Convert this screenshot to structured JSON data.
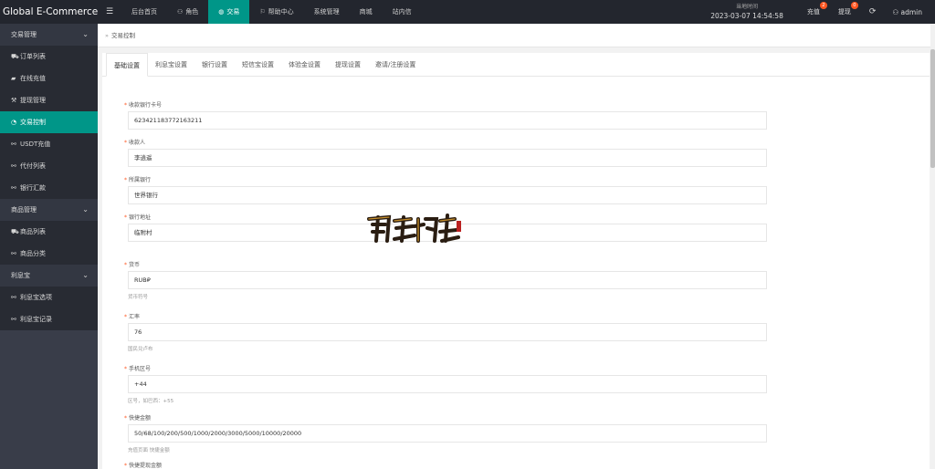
{
  "app": {
    "title": "Global E-Commerce...",
    "menu_toggle": "☰"
  },
  "topnav": [
    {
      "icon": "",
      "label": "后台首页"
    },
    {
      "icon": "user-icon",
      "label": "角色"
    },
    {
      "icon": "globe-icon",
      "label": "交易",
      "active": true
    },
    {
      "icon": "flag-icon",
      "label": "帮助中心"
    },
    {
      "icon": "",
      "label": "系统管理"
    },
    {
      "icon": "",
      "label": "商城"
    },
    {
      "icon": "",
      "label": "站内信"
    }
  ],
  "header": {
    "clock_label": "当地时间",
    "clock_value": "2023-03-07 14:54:58",
    "recharge_label": "充值",
    "recharge_badge": "2",
    "withdraw_label": "提现",
    "withdraw_badge": "0",
    "refresh_icon": "refresh-icon",
    "user_name": "admin"
  },
  "sidebar": {
    "groups": [
      {
        "label": "交易管理",
        "items": [
          {
            "icon": "cart-icon",
            "label": "订单列表"
          },
          {
            "icon": "chat-icon",
            "label": "在线充值"
          },
          {
            "icon": "gavel-icon",
            "label": "提现管理"
          },
          {
            "icon": "gauge-icon",
            "label": "交易控制",
            "active": true
          },
          {
            "icon": "link-icon",
            "label": "USDT充值"
          },
          {
            "icon": "link-icon",
            "label": "代付列表"
          },
          {
            "icon": "link-icon",
            "label": "银行汇款"
          }
        ]
      },
      {
        "label": "商品管理",
        "items": [
          {
            "icon": "cart-icon",
            "label": "商品列表"
          },
          {
            "icon": "link-icon",
            "label": "商品分类"
          }
        ]
      },
      {
        "label": "利息宝",
        "items": [
          {
            "icon": "link-icon",
            "label": "利息宝选项"
          },
          {
            "icon": "link-icon",
            "label": "利息宝记录"
          }
        ]
      }
    ]
  },
  "breadcrumb": {
    "label": "交易控制"
  },
  "tabs": [
    "基础设置",
    "利息宝设置",
    "银行设置",
    "短信宝设置",
    "体验金设置",
    "提现设置",
    "邀请/注册设置"
  ],
  "form": {
    "fields": [
      {
        "label": "收款银行卡号",
        "value": "6234211837721632​11",
        "hint": ""
      },
      {
        "label": "收款人",
        "value": "李逍遥",
        "hint": ""
      },
      {
        "label": "所属银行",
        "value": "世界银行",
        "hint": ""
      },
      {
        "label": "银行地址",
        "value": "临附村",
        "hint": ""
      },
      {
        "label": "货币",
        "value": "RUB₽",
        "hint": "货币符号"
      },
      {
        "label": "汇率",
        "value": "76",
        "hint": "国民兑卢布"
      },
      {
        "label": "手机区号",
        "value": "+44",
        "hint": "区号，如巴西：+55"
      },
      {
        "label": "快捷金额",
        "value": "50/68/100/200/500/1000/2000/3000/5000/10000/20000",
        "hint": "充值页面 快捷金额"
      },
      {
        "label": "快捷提现金额",
        "value": "",
        "hint": ""
      }
    ]
  }
}
